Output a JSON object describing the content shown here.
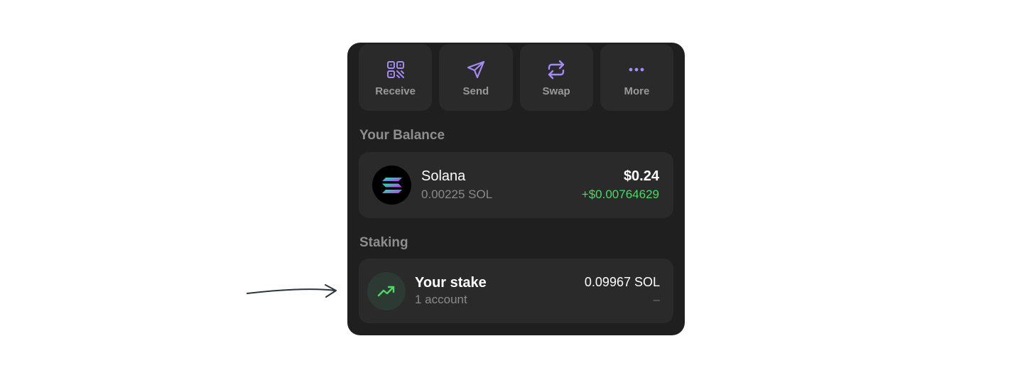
{
  "actions": [
    {
      "label": "Receive",
      "icon": "qr-code-icon"
    },
    {
      "label": "Send",
      "icon": "send-icon"
    },
    {
      "label": "Swap",
      "icon": "swap-icon"
    },
    {
      "label": "More",
      "icon": "more-icon"
    }
  ],
  "balance": {
    "title": "Your Balance",
    "token_name": "Solana",
    "token_amount": "0.00225 SOL",
    "usd_value": "$0.24",
    "usd_change": "+$0.00764629"
  },
  "staking": {
    "title": "Staking",
    "label": "Your stake",
    "accounts": "1 account",
    "amount": "0.09967 SOL",
    "change": "–"
  },
  "colors": {
    "accent_purple": "#a48bf5",
    "positive_green": "#4cd964",
    "panel_bg": "#1f1f1f",
    "card_bg": "#2a2a2a"
  }
}
